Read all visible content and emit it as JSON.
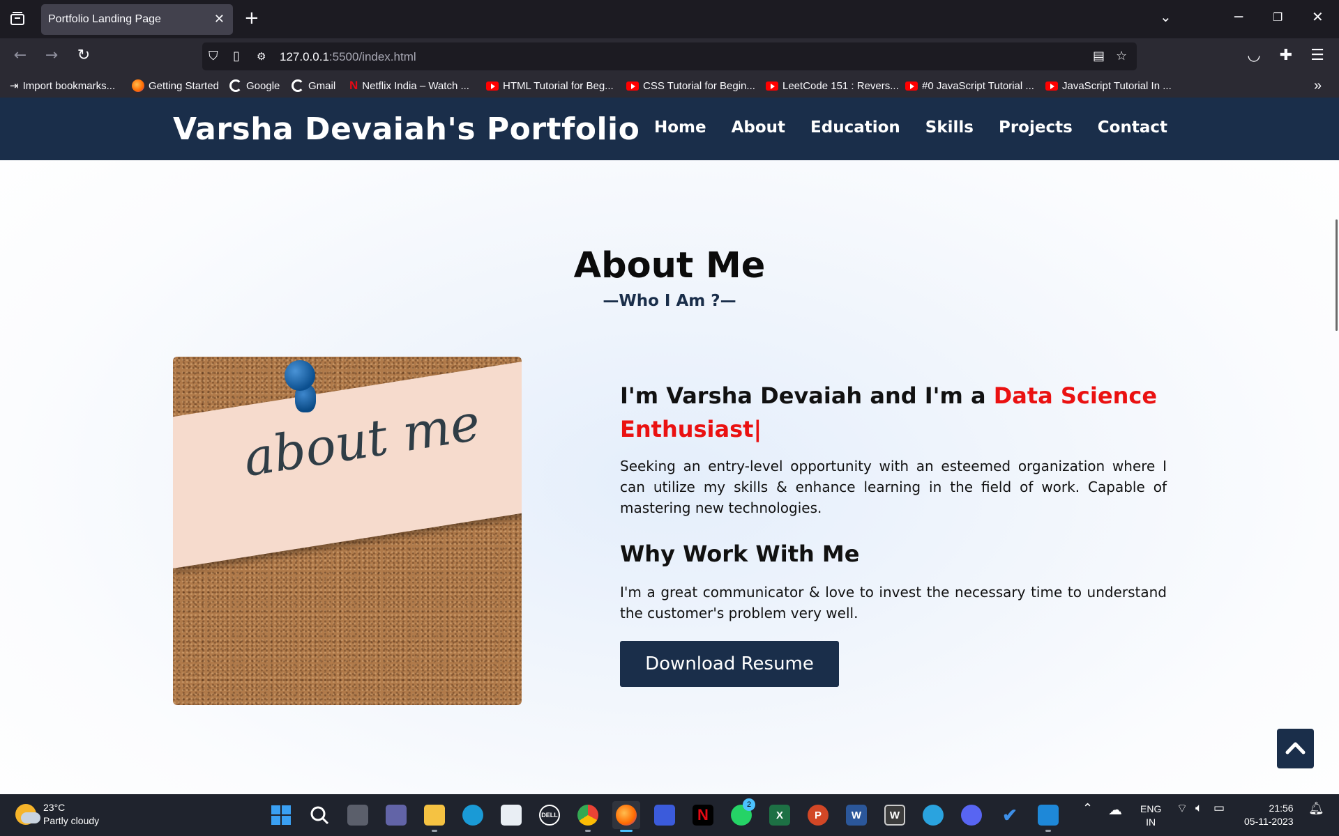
{
  "browser": {
    "tab_title": "Portfolio Landing Page",
    "url_host": "127.0.0.1",
    "url_rest": ":5500/index.html",
    "bookmarks": [
      {
        "label": "Import bookmarks...",
        "icon": "import-icon"
      },
      {
        "label": "Getting Started",
        "icon": "firefox-icon"
      },
      {
        "label": "Google",
        "icon": "google-icon"
      },
      {
        "label": "Gmail",
        "icon": "google-icon"
      },
      {
        "label": "Netflix India – Watch ...",
        "icon": "netflix-icon"
      },
      {
        "label": "HTML Tutorial for Beg...",
        "icon": "youtube-icon"
      },
      {
        "label": "CSS Tutorial for Begin...",
        "icon": "youtube-icon"
      },
      {
        "label": "LeetCode 151 : Revers...",
        "icon": "youtube-icon"
      },
      {
        "label": "#0 JavaScript Tutorial ...",
        "icon": "youtube-icon"
      },
      {
        "label": "JavaScript Tutorial In ...",
        "icon": "youtube-icon"
      }
    ]
  },
  "site": {
    "brand": "Varsha Devaiah's Portfolio",
    "nav": [
      "Home",
      "About",
      "Education",
      "Skills",
      "Projects",
      "Contact"
    ],
    "about": {
      "title": "About Me",
      "subtitle": "—Who I Am ?—",
      "image_text": "about me",
      "intro_prefix": "I'm Varsha Devaiah and I'm a ",
      "intro_role": "Data Science Enthusiast",
      "intro_cursor": "|",
      "paragraph1": "Seeking an entry-level opportunity with an esteemed organization where I can utilize my skills & enhance learning in the field of work. Capable of mastering new technologies.",
      "why_title": "Why Work With Me",
      "paragraph2": "I'm a great communicator & love to invest the necessary time to understand the customer's problem very well.",
      "resume_button": "Download Resume"
    },
    "colors": {
      "header": "#1a2e4a",
      "accent": "#ea1111"
    }
  },
  "taskbar": {
    "weather_temp": "23°C",
    "weather_desc": "Partly cloudy",
    "lang_line1": "ENG",
    "lang_line2": "IN",
    "time": "21:56",
    "date": "05-11-2023",
    "whatsapp_badge": "2"
  }
}
